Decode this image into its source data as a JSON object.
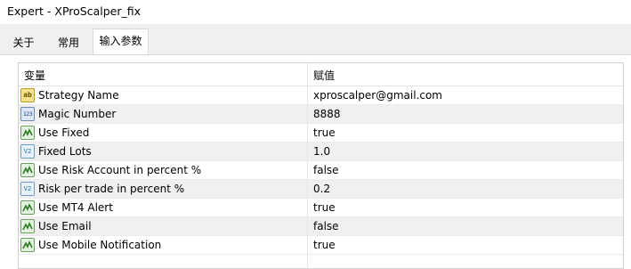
{
  "window": {
    "title": "Expert - XProScalper_fix"
  },
  "tabs": [
    {
      "label": "关于",
      "active": false
    },
    {
      "label": "常用",
      "active": false
    },
    {
      "label": "输入参数",
      "active": true
    }
  ],
  "grid": {
    "columns": {
      "variable": "变量",
      "value": "赋值"
    },
    "rows": [
      {
        "name": "Strategy Name",
        "value": "xproscalper@gmail.com",
        "type": "string",
        "icon": "string-type-icon",
        "glyph": "ab"
      },
      {
        "name": "Magic Number",
        "value": "8888",
        "type": "int",
        "icon": "integer-type-icon",
        "glyph": "123"
      },
      {
        "name": "Use Fixed",
        "value": "true",
        "type": "bool",
        "icon": "boolean-type-icon",
        "glyph": ""
      },
      {
        "name": "Fixed Lots",
        "value": "1.0",
        "type": "double",
        "icon": "double-type-icon",
        "glyph": "V2"
      },
      {
        "name": "Use Risk Account in percent %",
        "value": "false",
        "type": "bool",
        "icon": "boolean-type-icon",
        "glyph": ""
      },
      {
        "name": "Risk per trade in percent %",
        "value": "0.2",
        "type": "double",
        "icon": "double-type-icon",
        "glyph": "V2"
      },
      {
        "name": "Use MT4 Alert",
        "value": "true",
        "type": "bool",
        "icon": "boolean-type-icon",
        "glyph": ""
      },
      {
        "name": "Use Email",
        "value": "false",
        "type": "bool",
        "icon": "boolean-type-icon",
        "glyph": ""
      },
      {
        "name": "Use Mobile Notification",
        "value": "true",
        "type": "bool",
        "icon": "boolean-type-icon",
        "glyph": ""
      }
    ]
  },
  "colors": {
    "tabstrip_bg": "#f0f0f0",
    "alt_row_bg": "#f0f0f0",
    "border": "#d0d0d0"
  }
}
